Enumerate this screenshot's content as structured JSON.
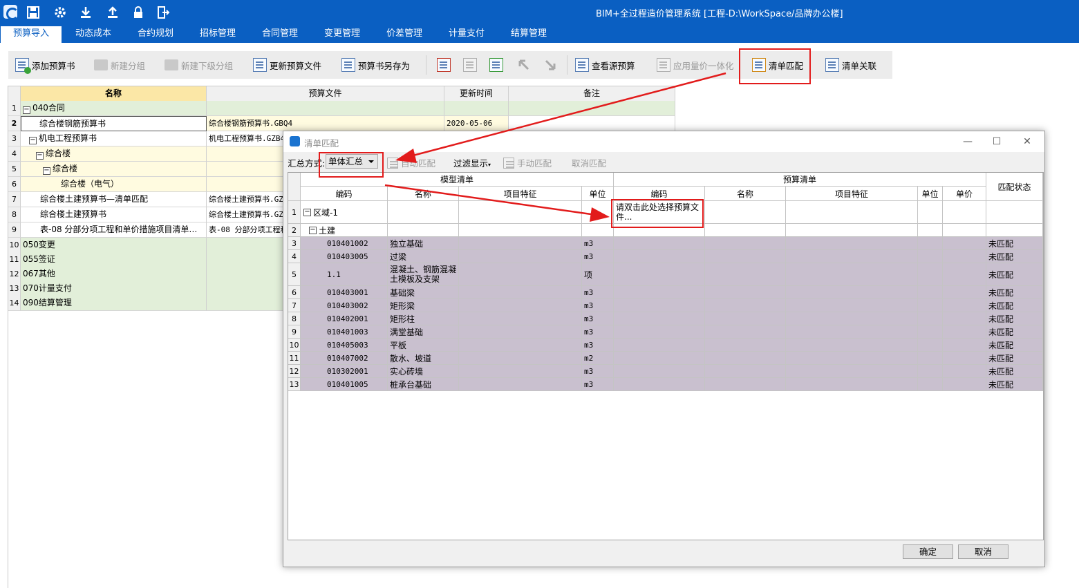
{
  "app": {
    "title": "BIM+全过程造价管理系统 [工程-D:\\WorkSpace/品牌办公楼]",
    "quick_icons": [
      "app-logo",
      "save-icon",
      "settings-icon",
      "download-icon",
      "upload-icon",
      "lock-icon",
      "exit-icon"
    ]
  },
  "menu": [
    {
      "label": "预算导入",
      "active": true
    },
    {
      "label": "动态成本"
    },
    {
      "label": "合约规划"
    },
    {
      "label": "招标管理"
    },
    {
      "label": "合同管理"
    },
    {
      "label": "变更管理"
    },
    {
      "label": "价差管理"
    },
    {
      "label": "计量支付"
    },
    {
      "label": "结算管理"
    }
  ],
  "toolbar": {
    "add_budget": "添加预算书",
    "new_group": "新建分组",
    "new_subgroup": "新建下级分组",
    "update_file": "更新预算文件",
    "save_as": "预算书另存为",
    "view_source": "查看源预算",
    "apply_integration": "应用量价一体化",
    "bill_match": "清单匹配",
    "bill_link": "清单关联"
  },
  "main_grid": {
    "columns": [
      "名称",
      "预算文件",
      "更新时间",
      "备注"
    ],
    "rows": [
      {
        "num": "1",
        "name": "040合同",
        "file": "",
        "time": "",
        "note": ""
      },
      {
        "num": "2",
        "name": "综合楼钢筋预算书",
        "file": "综合楼钢筋预算书.GBQ4",
        "time": "2020-05-06",
        "note": ""
      },
      {
        "num": "3",
        "name": "机电工程预算书",
        "file": "机电工程预算书.GZB4",
        "time": "",
        "note": ""
      },
      {
        "num": "4",
        "name": "综合楼",
        "file": "",
        "time": "",
        "note": ""
      },
      {
        "num": "5",
        "name": "综合楼",
        "file": "",
        "time": "",
        "note": ""
      },
      {
        "num": "6",
        "name": "综合楼（电气）",
        "file": "",
        "time": "",
        "note": ""
      },
      {
        "num": "7",
        "name": "综合楼土建预算书—清单匹配",
        "file": "综合楼土建预算书.GZ",
        "time": "",
        "note": ""
      },
      {
        "num": "8",
        "name": "综合楼土建预算书",
        "file": "综合楼土建预算书.GZ",
        "time": "",
        "note": ""
      },
      {
        "num": "9",
        "name": "表-08 分部分项工程和单价措施项目清单…",
        "file": "表-08 分部分项工程和",
        "time": "",
        "note": ""
      },
      {
        "num": "10",
        "name": "050变更",
        "file": "",
        "time": "",
        "note": ""
      },
      {
        "num": "11",
        "name": "055签证",
        "file": "",
        "time": "",
        "note": ""
      },
      {
        "num": "12",
        "name": "067其他",
        "file": "",
        "time": "",
        "note": ""
      },
      {
        "num": "13",
        "name": "070计量支付",
        "file": "",
        "time": "",
        "note": ""
      },
      {
        "num": "14",
        "name": "090结算管理",
        "file": "",
        "time": "",
        "note": ""
      }
    ]
  },
  "dialog": {
    "title": "清单匹配",
    "summary_label": "汇总方式:",
    "summary_value": "单体汇总",
    "auto_match": "自动匹配",
    "filter": "过滤显示",
    "manual_match": "手动匹配",
    "cancel_match": "取消匹配",
    "group_model": "模型清单",
    "group_budget": "预算清单",
    "col_status": "匹配状态",
    "model_cols": [
      "编码",
      "名称",
      "项目特征",
      "单位"
    ],
    "budget_cols": [
      "编码",
      "名称",
      "项目特征",
      "单位",
      "单价"
    ],
    "hint": "请双击此处选择预算文件...",
    "region": "区域-1",
    "discipline": "土建",
    "rows": [
      {
        "num": "3",
        "code": "010401002",
        "name": "独立基础",
        "unit": "m3",
        "status": "未匹配"
      },
      {
        "num": "4",
        "code": "010403005",
        "name": "过梁",
        "unit": "m3",
        "status": "未匹配"
      },
      {
        "num": "5",
        "code": "1.1",
        "name": "混凝土、钢筋混凝土模板及支架",
        "unit": "项",
        "status": "未匹配"
      },
      {
        "num": "6",
        "code": "010403001",
        "name": "基础梁",
        "unit": "m3",
        "status": "未匹配"
      },
      {
        "num": "7",
        "code": "010403002",
        "name": "矩形梁",
        "unit": "m3",
        "status": "未匹配"
      },
      {
        "num": "8",
        "code": "010402001",
        "name": "矩形柱",
        "unit": "m3",
        "status": "未匹配"
      },
      {
        "num": "9",
        "code": "010401003",
        "name": "满堂基础",
        "unit": "m3",
        "status": "未匹配"
      },
      {
        "num": "10",
        "code": "010405003",
        "name": "平板",
        "unit": "m3",
        "status": "未匹配"
      },
      {
        "num": "11",
        "code": "010407002",
        "name": "散水、坡道",
        "unit": "m2",
        "status": "未匹配"
      },
      {
        "num": "12",
        "code": "010302001",
        "name": "实心砖墙",
        "unit": "m3",
        "status": "未匹配"
      },
      {
        "num": "13",
        "code": "010401005",
        "name": "桩承台基础",
        "unit": "m3",
        "status": "未匹配"
      }
    ],
    "ok": "确定",
    "cancel": "取消"
  },
  "colors": {
    "titlebar": "#0a5fc2",
    "highlight_red": "#e21b1b",
    "unmatched_row": "#c9c0cf",
    "group_green": "#e2efd9",
    "child_yellow": "#fffbe0"
  }
}
